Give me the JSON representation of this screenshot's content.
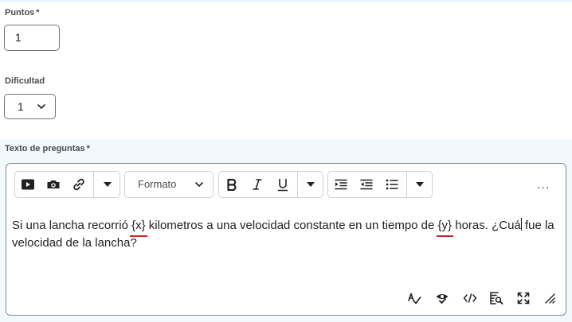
{
  "points": {
    "label": "Puntos",
    "required_mark": "*",
    "value": "1"
  },
  "difficulty": {
    "label": "Dificultad",
    "selected": "1"
  },
  "question_text": {
    "label": "Texto de preguntas",
    "required_mark": "*",
    "toolbar": {
      "format_label": "Formato",
      "more_label": "..."
    },
    "content": {
      "p1": "Si una lancha recorrió ",
      "var1": "{x}",
      "p2": " kilometros a una velocidad constante en un tiempo de ",
      "var2": "{y}",
      "p3": " horas. ¿Cuá",
      "p4": " fue la velocidad de la lancha?"
    }
  },
  "colors": {
    "accent_underline": "#cd2026",
    "section_bg": "#f1f9fd",
    "border": "#6e7477"
  }
}
